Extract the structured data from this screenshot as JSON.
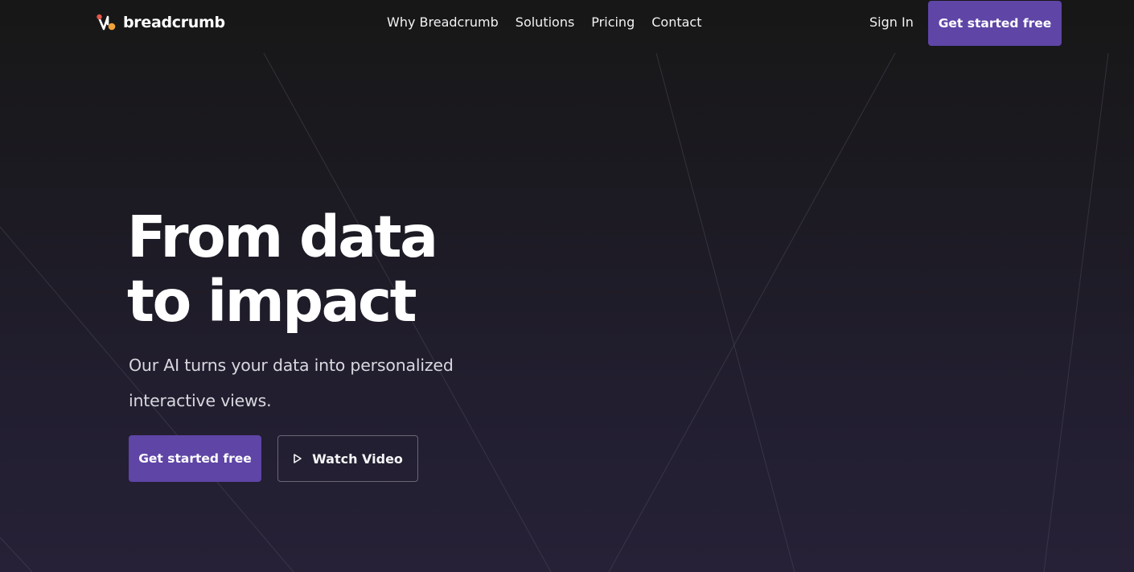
{
  "brand": {
    "name": "breadcrumb",
    "logo_icon": "breadcrumb-logo-icon",
    "colors": {
      "accent": "#5e45a6",
      "logo_red": "#e2574c",
      "logo_orange": "#f2a23a"
    }
  },
  "nav": {
    "links": [
      {
        "label": "Why Breadcrumb"
      },
      {
        "label": "Solutions"
      },
      {
        "label": "Pricing"
      },
      {
        "label": "Contact"
      }
    ],
    "sign_in_label": "Sign In",
    "cta_label": "Get started free"
  },
  "hero": {
    "title_line1": "From data",
    "title_line2": "to impact",
    "subtitle": "Our AI turns your data into personalized interactive views.",
    "primary_cta_label": "Get started free",
    "secondary_cta_label": "Watch Video",
    "secondary_cta_icon": "play-icon"
  }
}
